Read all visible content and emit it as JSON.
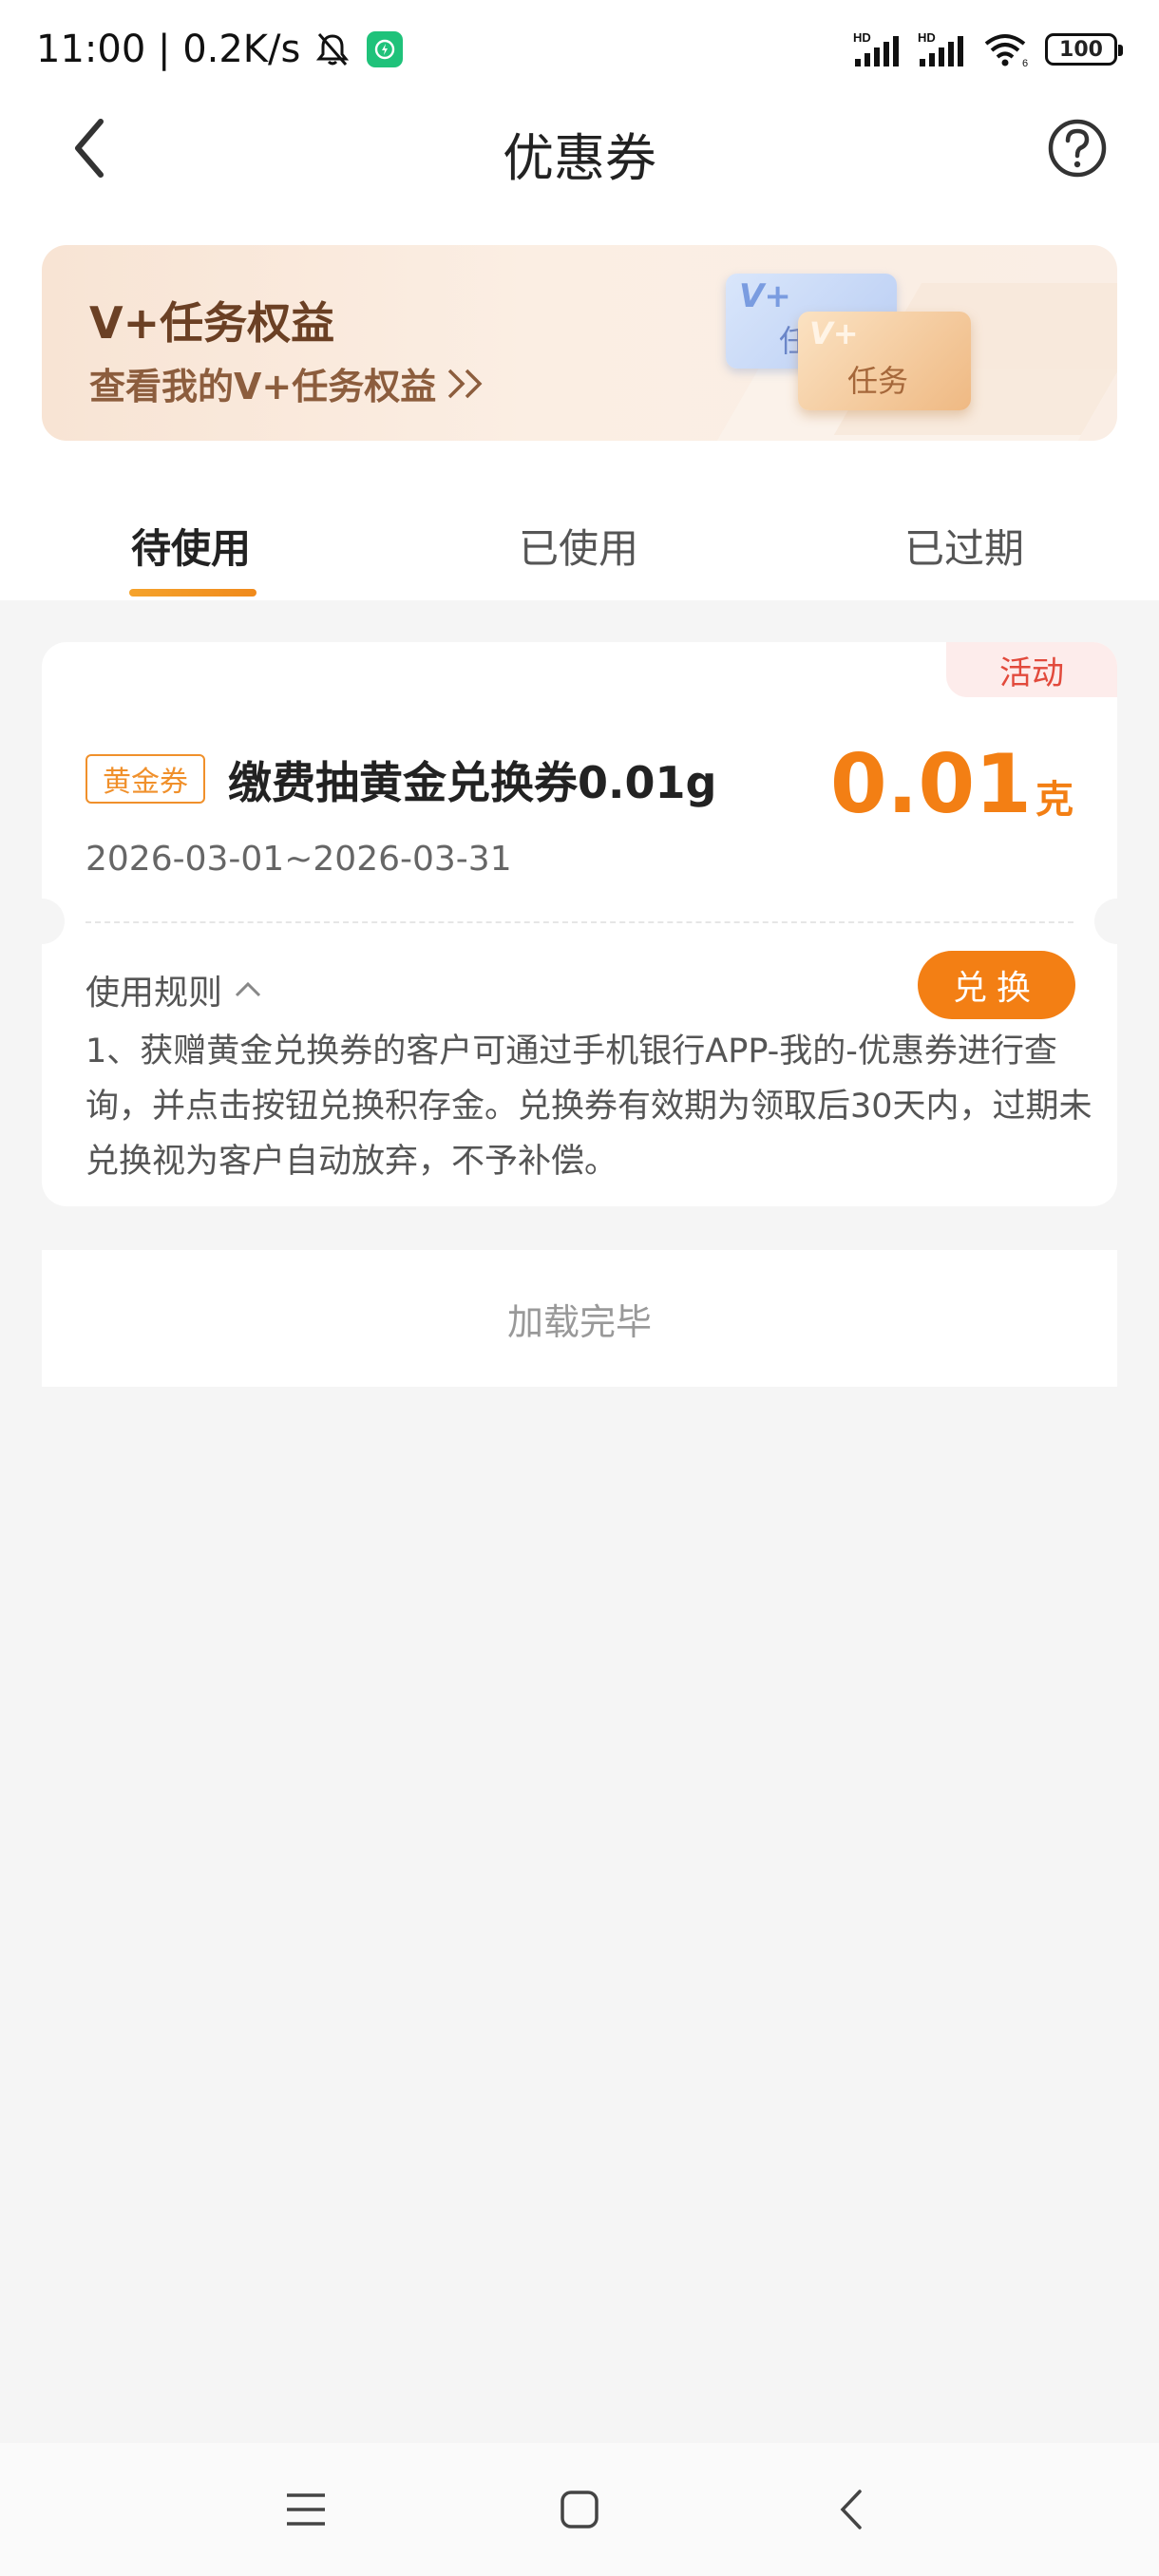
{
  "status_bar": {
    "time": "11:00",
    "net_speed": "0.2K/s",
    "battery": "100"
  },
  "header": {
    "title": "优惠券"
  },
  "banner": {
    "title": "V+任务权益",
    "subtitle": "查看我的V+任务权益",
    "card1_top": "V+",
    "card1_bottom": "任",
    "card2_top": "V+",
    "card2_bottom": "任务"
  },
  "tabs": [
    {
      "label": "待使用",
      "active": true
    },
    {
      "label": "已使用"
    },
    {
      "label": "已过期"
    }
  ],
  "coupon": {
    "tag": "活动",
    "type_label": "黄金券",
    "name": "缴费抽黄金兑换券0.01g",
    "value": "0.01",
    "unit": "克",
    "date_range": "2026-03-01~2026-03-31",
    "rules_label": "使用规则",
    "redeem_label": "兑换",
    "rules_text": "1、获赠黄金兑换券的客户可通过手机银行APP-我的-优惠券进行查询，并点击按钮兑换积存金。兑换券有效期为领取后30天内，过期未兑换视为客户自动放弃，不予补偿。"
  },
  "list_footer": "加载完毕",
  "colors": {
    "accent": "#f37f14",
    "activity_red": "#e24a3c",
    "banner_brown": "#6b4024"
  }
}
